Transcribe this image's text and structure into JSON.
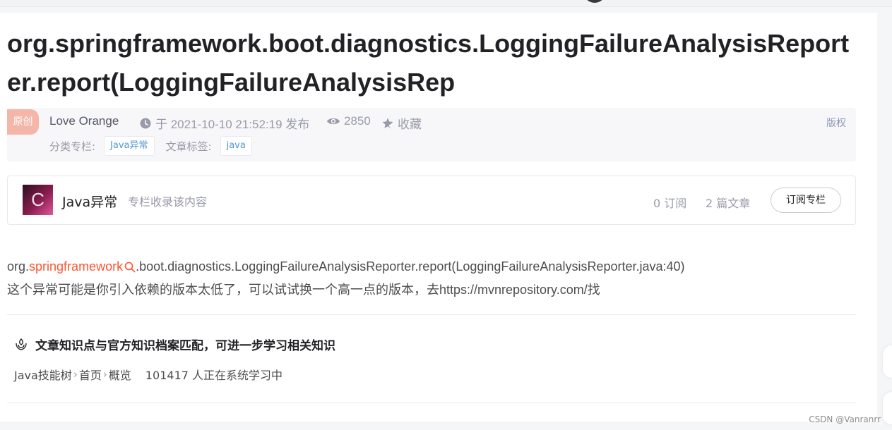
{
  "article": {
    "title": "org.springframework.boot.diagnostics.LoggingFailureAnalysisReporter.report(LoggingFailureAnalysisRep",
    "original_badge": "原创",
    "author": "Love Orange",
    "publish_time": "于 2021-10-10 21:52:19 发布",
    "views": "2850",
    "favorite_label": "收藏",
    "copyright_label": "版权",
    "category_label": "分类专栏:",
    "category_tag": "Java异常",
    "tags_label": "文章标签:",
    "tag": "java",
    "body": {
      "line1_prefix": "org.",
      "line1_keyword": "springframework",
      "line1_suffix": ".boot.diagnostics.LoggingFailureAnalysisReporter.report(LoggingFailureAnalysisReporter.java:40)",
      "line2": "这个异常可能是你引入依赖的版本太低了，可以试试换一个高一点的版本，去https://mvnrepository.com/找"
    }
  },
  "column": {
    "avatar_letter": "C",
    "name": "Java异常",
    "description": "专栏收录该内容",
    "subscribers": "0 订阅",
    "articles": "2 篇文章",
    "subscribe_button": "订阅专栏"
  },
  "knowledge": {
    "title": "文章知识点与官方知识档案匹配，可进一步学习相关知识",
    "path": [
      "Java技能树",
      "首页",
      "概览"
    ],
    "learners": "101417 人正在系统学习中"
  },
  "watermark": "CSDN @Vanranrr",
  "icons": {
    "time": "clock-icon",
    "views": "eye-icon",
    "favorite": "star-icon",
    "search": "search-icon",
    "knowledge": "knowledge-icon"
  },
  "colors": {
    "accent": "#fc5531",
    "tag_text": "#5094d5",
    "badge_bg": "#f3b6a9",
    "muted": "#999aaa"
  }
}
